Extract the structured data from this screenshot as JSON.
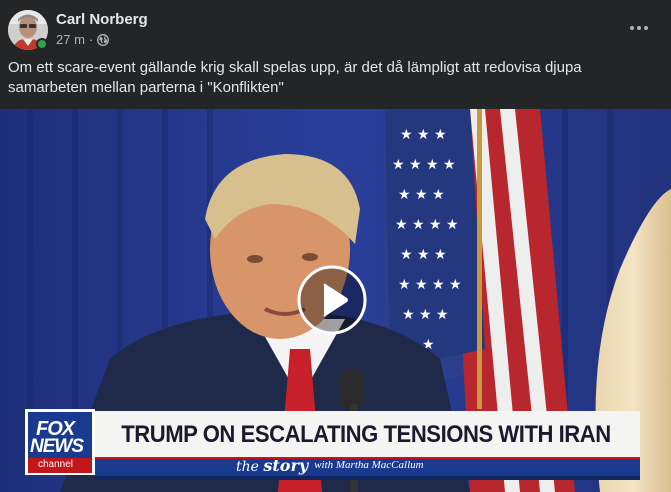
{
  "post": {
    "author": "Carl Norberg",
    "time": "27 m",
    "separator": "·",
    "visibility_icon": "globe-icon",
    "text": "Om ett scare-event gällande krig skall spelas upp, är det då lämpligt att redovisa djupa samarbeten mellan parterna i \"Konflikten\""
  },
  "video": {
    "chyron_title": "TRUMP ON ESCALATING TENSIONS WITH IRAN",
    "show_name_a": "the",
    "show_name_b": "story",
    "show_host": "with Martha MacCallum",
    "logo_line1": "FOX",
    "logo_line2": "NEWS",
    "logo_line3": "channel",
    "play_icon": "play-icon"
  },
  "colors": {
    "background": "#242526",
    "text_primary": "#e4e6eb",
    "text_secondary": "#b0b3b8",
    "online": "#31a24c",
    "fox_blue": "#1a3a8f"
  }
}
